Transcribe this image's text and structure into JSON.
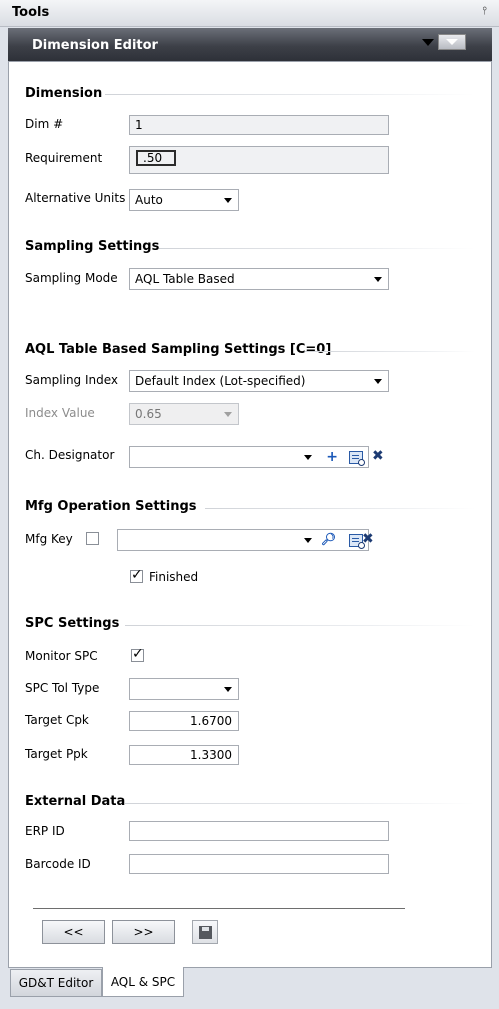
{
  "header": {
    "title": "Tools",
    "pin_icon": "pin-icon"
  },
  "editor": {
    "title": "Dimension Editor"
  },
  "dimension": {
    "section": "Dimension",
    "dim_label": "Dim #",
    "dim_value": "1",
    "req_label": "Requirement",
    "req_value": ".50",
    "alt_units_label": "Alternative Units",
    "alt_units_value": "Auto"
  },
  "sampling": {
    "section": "Sampling Settings",
    "mode_label": "Sampling Mode",
    "mode_value": "AQL Table Based"
  },
  "aql": {
    "section": "AQL Table Based Sampling Settings [C=0]",
    "index_label": "Sampling Index",
    "index_value": "Default Index (Lot-specified)",
    "index_value_label": "Index Value",
    "index_value_value": "0.65",
    "ch_label": "Ch. Designator",
    "ch_value": ""
  },
  "mfg": {
    "section": "Mfg Operation Settings",
    "key_label": "Mfg Key",
    "key_checked": false,
    "key_value": "",
    "finished_label": "Finished",
    "finished_checked": true
  },
  "spc": {
    "section": "SPC Settings",
    "monitor_label": "Monitor SPC",
    "monitor_checked": true,
    "tol_type_label": "SPC Tol Type",
    "tol_type_value": "",
    "cpk_label": "Target Cpk",
    "cpk_value": "1.6700",
    "ppk_label": "Target Ppk",
    "ppk_value": "1.3300"
  },
  "external": {
    "section": "External Data",
    "erp_label": "ERP ID",
    "erp_value": "",
    "barcode_label": "Barcode ID",
    "barcode_value": ""
  },
  "nav": {
    "prev_label": "<<",
    "next_label": ">>"
  },
  "tabs": [
    {
      "label": "GD&T Editor",
      "active": false
    },
    {
      "label": "AQL & SPC",
      "active": true
    }
  ]
}
